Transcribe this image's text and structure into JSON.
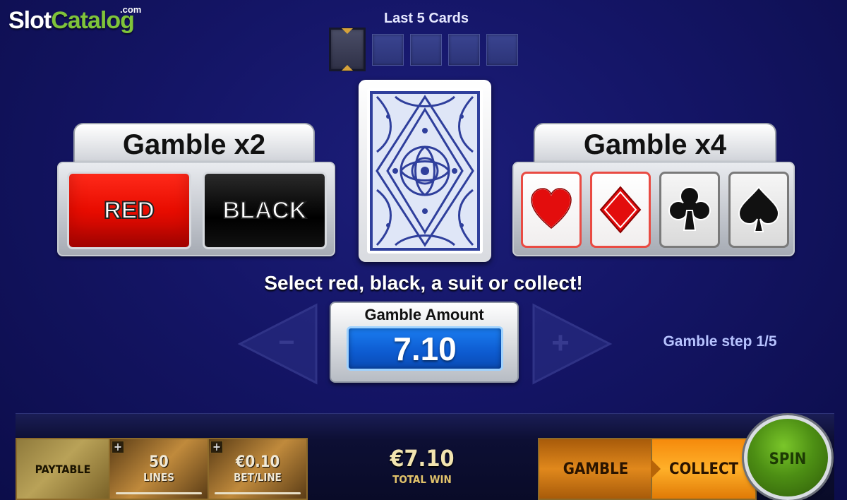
{
  "logo": {
    "slot": "Slot",
    "catalog": "Catalog",
    "com": ".com"
  },
  "history": {
    "label": "Last 5 Cards",
    "count": 5
  },
  "gamble_color": {
    "title": "Gamble x2",
    "red_label": "RED",
    "black_label": "BLACK"
  },
  "gamble_suit": {
    "title": "Gamble x4",
    "suits": [
      "heart-icon",
      "diamond-icon",
      "club-icon",
      "spade-icon"
    ]
  },
  "card": {
    "face": "card-back"
  },
  "instruction": "Select red, black, a suit or collect!",
  "amount": {
    "label": "Gamble Amount",
    "value": "7.10",
    "minus": "−",
    "plus": "+"
  },
  "step": "Gamble step  1/5",
  "bottom": {
    "paytable": "PAYTABLE",
    "lines_value": "50",
    "lines_label": "LINES",
    "bet_value": "€0.10",
    "bet_label": "BET/LINE",
    "plus_tag": "+",
    "total_win_value": "€7.10",
    "total_win_label": "TOTAL WIN",
    "gamble": "GAMBLE",
    "collect": "COLLECT",
    "spin": "SPIN"
  },
  "colors": {
    "accent_red": "#e80c00",
    "accent_blue": "#0d5bd0",
    "background": "#141566",
    "spin_green": "#4d8f14",
    "collect_orange": "#ffb029"
  }
}
